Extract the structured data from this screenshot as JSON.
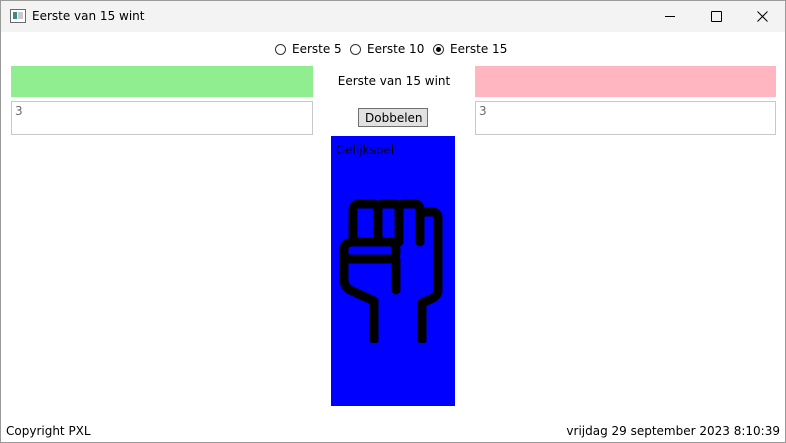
{
  "window": {
    "title": "Eerste van 15 wint"
  },
  "options": [
    {
      "label": "Eerste 5",
      "checked": false
    },
    {
      "label": "Eerste 10",
      "checked": false
    },
    {
      "label": "Eerste 15",
      "checked": true
    }
  ],
  "game": {
    "status_label": "Eerste van 15 wint",
    "left_score": "3",
    "right_score": "3",
    "dice_button_label": "Dobbelen",
    "panel_label": "Gelijkspel",
    "panel_icon": "fist-icon"
  },
  "colors": {
    "left_bar": "#90EE90",
    "right_bar": "#FFB6C1",
    "panel": "#0000FF"
  },
  "footer": {
    "copyright": "Copyright PXL",
    "datetime": "vrijdag 29 september 2023 8:10:39"
  }
}
